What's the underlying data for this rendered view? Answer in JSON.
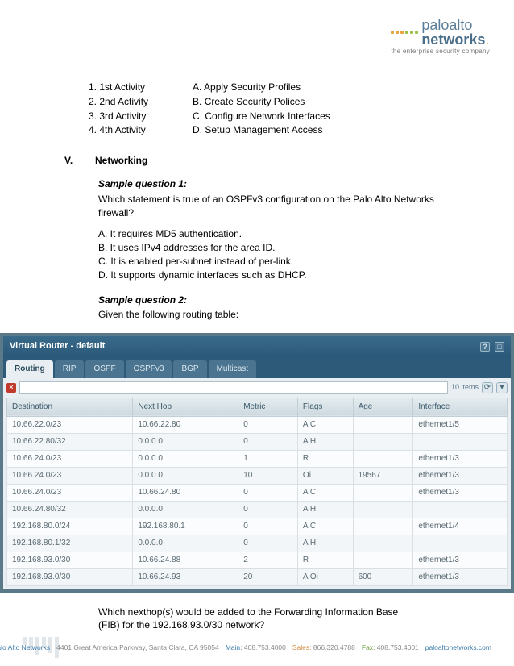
{
  "logo": {
    "line1": "paloalto",
    "line2": "networks",
    "tag": "the enterprise security company"
  },
  "activities": {
    "numbered": [
      "1.  1st Activity",
      "2.  2nd Activity",
      "3.  3rd Activity",
      "4.  4th Activity"
    ],
    "lettered": [
      "A. Apply Security Profiles",
      "B. Create Security Polices",
      "C. Configure Network Interfaces",
      "D. Setup Management Access"
    ]
  },
  "section": {
    "num": "V.",
    "title": "Networking"
  },
  "q1": {
    "title": "Sample question 1:",
    "text": "Which statement is true of an OSPFv3 configuration on the Palo Alto Networks firewall?",
    "opts": [
      "A.  It requires MD5 authentication.",
      "B.  It uses IPv4 addresses for the area ID.",
      "C.  It is enabled per-subnet instead of per-link.",
      "D.  It supports dynamic interfaces such as DHCP."
    ]
  },
  "q2": {
    "title": "Sample question 2:",
    "text": "Given the following routing table:"
  },
  "panel": {
    "title": "Virtual Router - default",
    "tabs": [
      "Routing",
      "RIP",
      "OSPF",
      "OSPFv3",
      "BGP",
      "Multicast"
    ],
    "items_label": "10 items",
    "headers": [
      "Destination",
      "Next Hop",
      "Metric",
      "Flags",
      "Age",
      "Interface"
    ],
    "rows": [
      [
        "10.66.22.0/23",
        "10.66.22.80",
        "0",
        "A C",
        "",
        "ethernet1/5"
      ],
      [
        "10.66.22.80/32",
        "0.0.0.0",
        "0",
        "A H",
        "",
        ""
      ],
      [
        "10.66.24.0/23",
        "0.0.0.0",
        "1",
        "R",
        "",
        "ethernet1/3"
      ],
      [
        "10.66.24.0/23",
        "0.0.0.0",
        "10",
        "Oi",
        "19567",
        "ethernet1/3"
      ],
      [
        "10.66.24.0/23",
        "10.66.24.80",
        "0",
        "A C",
        "",
        "ethernet1/3"
      ],
      [
        "10.66.24.80/32",
        "0.0.0.0",
        "0",
        "A H",
        "",
        ""
      ],
      [
        "192.168.80.0/24",
        "192.168.80.1",
        "0",
        "A C",
        "",
        "ethernet1/4"
      ],
      [
        "192.168.80.1/32",
        "0.0.0.0",
        "0",
        "A H",
        "",
        ""
      ],
      [
        "192.168.93.0/30",
        "10.66.24.88",
        "2",
        "R",
        "",
        "ethernet1/3"
      ],
      [
        "192.168.93.0/30",
        "10.66.24.93",
        "20",
        "A Oi",
        "600",
        "ethernet1/3"
      ]
    ]
  },
  "after": "Which nexthop(s) would be added to the Forwarding Information Base (FIB) for the 192.168.93.0/30 network?",
  "footer": {
    "company": "Palo Alto Networks",
    "addr": "4401 Great America Parkway, Santa Clara, CA 95054",
    "main_lbl": "Main:",
    "main": "408.753.4000",
    "sales_lbl": "Sales:",
    "sales": "866.320.4788",
    "fax_lbl": "Fax:",
    "fax": "408.753.4001",
    "url": "paloaltonetworks.com"
  }
}
